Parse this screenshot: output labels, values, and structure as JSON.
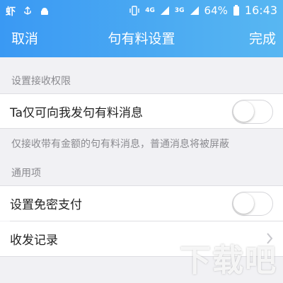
{
  "status_bar": {
    "app_icon": "虾",
    "signal_label": "4G",
    "network_label": "3G",
    "battery_percent": "64%",
    "time": "16:43"
  },
  "nav": {
    "cancel": "取消",
    "title": "句有料设置",
    "done": "完成"
  },
  "section_receive": {
    "label": "设置接收权限",
    "toggle_label": "Ta仅可向我发句有料消息",
    "toggle_on": false,
    "hint": "仅接收带有金额的句有料消息，普通消息将被屏蔽"
  },
  "section_general": {
    "label": "通用项",
    "pay_label": "设置免密支付",
    "pay_on": false,
    "records_label": "收发记录"
  },
  "watermark": {
    "text": "下载吧"
  }
}
